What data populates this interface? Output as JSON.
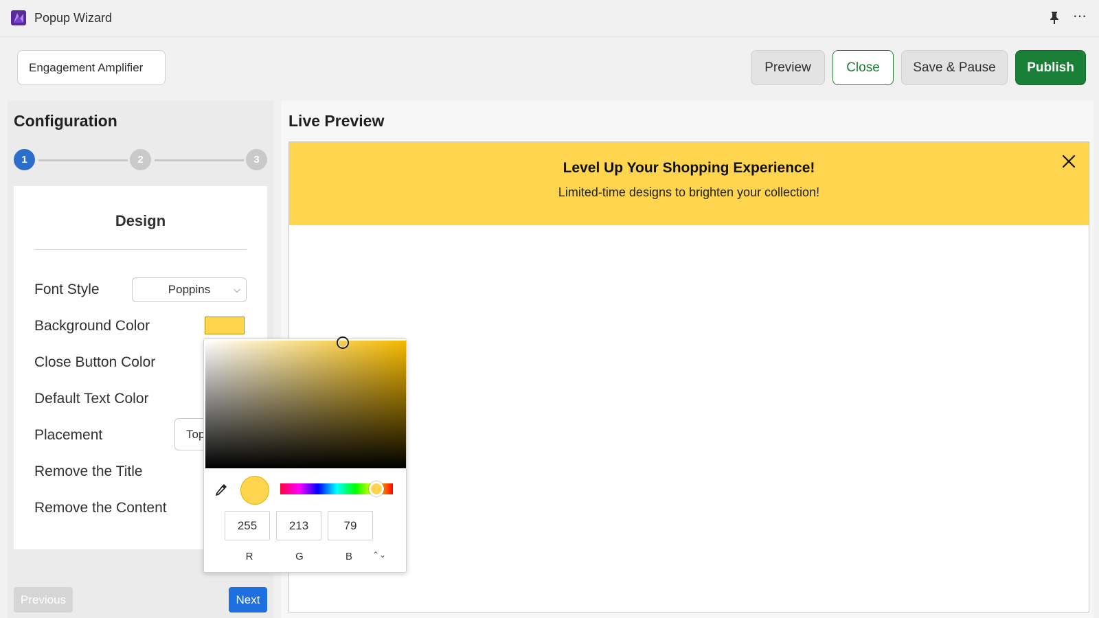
{
  "app": {
    "title": "Popup Wizard",
    "icon": "app-logo-icon"
  },
  "window_controls": {
    "pin": "pin-icon",
    "more": "⋯"
  },
  "header": {
    "campaign_name": "Engagement Amplifier",
    "buttons": {
      "preview": "Preview",
      "close": "Close",
      "save_pause": "Save & Pause",
      "publish": "Publish"
    }
  },
  "config": {
    "title": "Configuration",
    "steps": [
      "1",
      "2",
      "3"
    ],
    "active_step": 1,
    "design": {
      "title": "Design",
      "rows": {
        "font_style": "Font Style",
        "background_color": "Background Color",
        "close_button_color": "Close Button Color",
        "default_text_color": "Default Text Color",
        "placement": "Placement",
        "remove_title": "Remove the Title",
        "remove_content": "Remove the Content"
      },
      "font_value": "Poppins",
      "placement_value": "Top",
      "background_color_value": "#ffd54f"
    },
    "nav": {
      "previous": "Previous",
      "next": "Next"
    }
  },
  "preview": {
    "title": "Live Preview",
    "banner": {
      "headline": "Level Up Your Shopping Experience!",
      "text": "Limited-time designs to brighten your collection!",
      "background": "#ffd54f"
    }
  },
  "color_picker": {
    "r": "255",
    "g": "213",
    "b": "79",
    "labels": {
      "r": "R",
      "g": "G",
      "b": "B"
    },
    "mode_toggle": "⌃⌄"
  },
  "colors": {
    "primary_green": "#1a7f37",
    "step_blue": "#2c6ecb",
    "next_blue": "#1e6fe0"
  }
}
